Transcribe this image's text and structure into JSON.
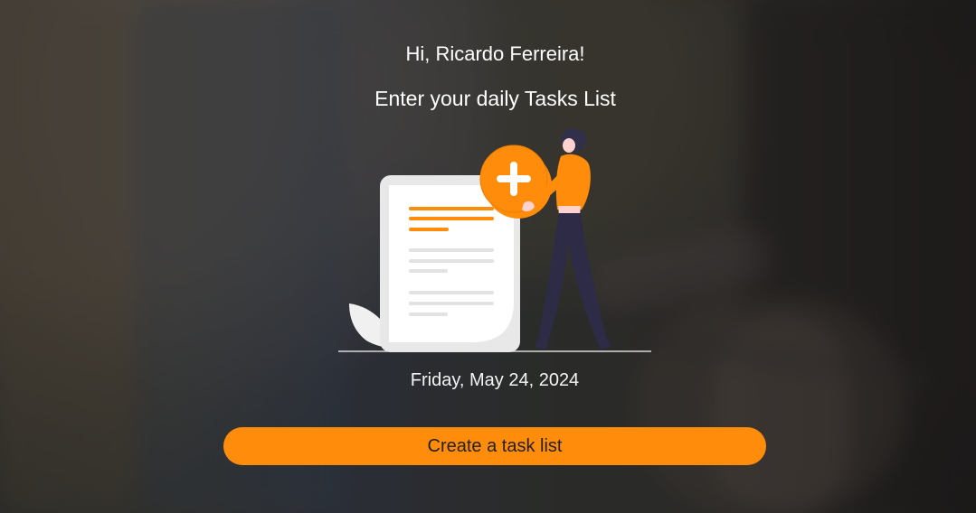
{
  "page": {
    "greeting": "Hi, Ricardo Ferreira!",
    "subtitle": "Enter your daily Tasks List",
    "date": "Friday, May 24, 2024",
    "cta_label": "Create a task list"
  },
  "colors": {
    "accent": "#ff8c0a",
    "text": "#ffffff",
    "button_text": "#222222"
  },
  "icons": {
    "illustration": "task-list-illustration",
    "add": "plus-icon"
  }
}
